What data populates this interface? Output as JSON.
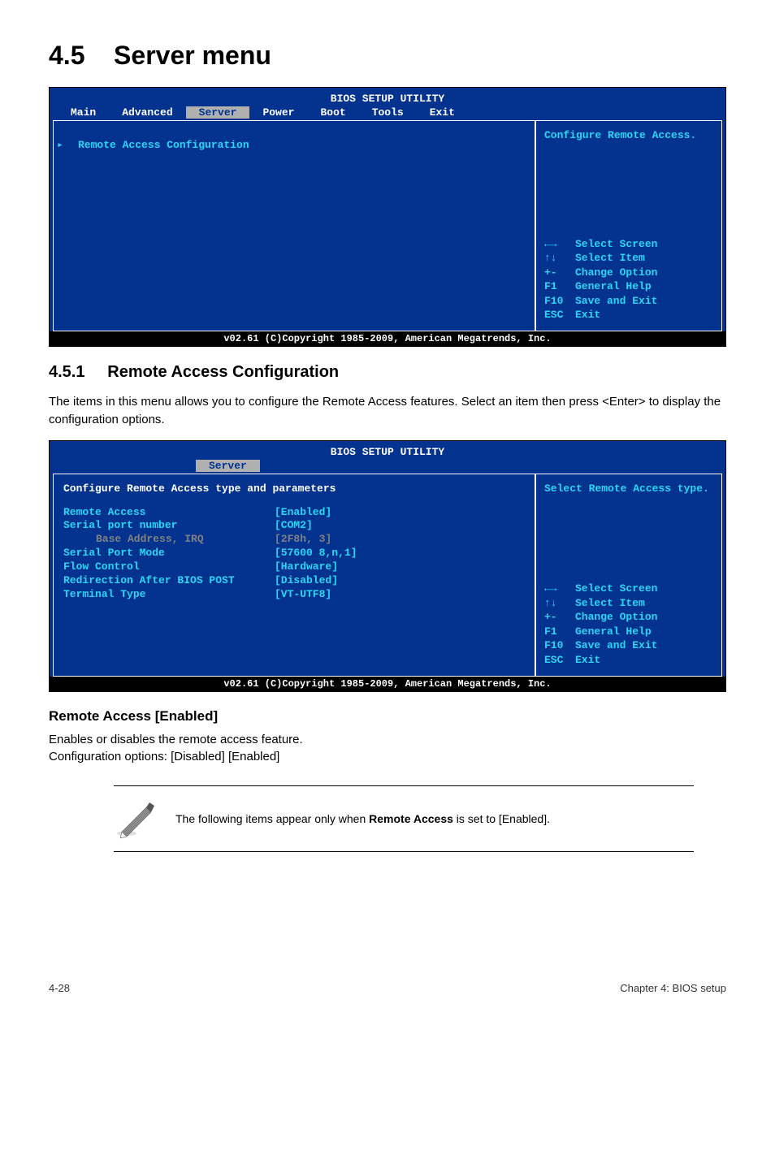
{
  "section_number": "4.5",
  "section_title": "Server menu",
  "bios1": {
    "title": "BIOS SETUP UTILITY",
    "tabs": [
      "Main",
      "Advanced",
      "Server",
      "Power",
      "Boot",
      "Tools",
      "Exit"
    ],
    "selected_tab": "Server",
    "left_item": "Remote Access Configuration",
    "right_top": "Configure Remote Access.",
    "help": [
      {
        "k": "←→",
        "t": "Select Screen"
      },
      {
        "k": "↑↓",
        "t": "Select Item"
      },
      {
        "k": "+-",
        "t": "Change Option"
      },
      {
        "k": "F1",
        "t": "General Help"
      },
      {
        "k": "F10",
        "t": "Save and Exit"
      },
      {
        "k": "ESC",
        "t": "Exit"
      }
    ],
    "footer": "v02.61 (C)Copyright 1985-2009, American Megatrends, Inc."
  },
  "sub_number": "4.5.1",
  "sub_title": "Remote Access Configuration",
  "sub_desc": "The items in this menu allows you to configure the Remote Access features. Select an item then press <Enter> to display the configuration options.",
  "bios2": {
    "title": "BIOS SETUP UTILITY",
    "tab": "Server",
    "heading": "Configure Remote Access type and parameters",
    "rows": [
      {
        "label": "Remote Access",
        "value": "[Enabled]",
        "labelClass": "cyan",
        "valClass": "cyan"
      },
      {
        "label": "",
        "value": "",
        "labelClass": "",
        "valClass": ""
      },
      {
        "label": "Serial port number",
        "value": "[COM2]",
        "labelClass": "cyan",
        "valClass": "cyan"
      },
      {
        "label": "Base Address, IRQ",
        "value": "[2F8h, 3]",
        "labelClass": "gray indent",
        "valClass": "gray"
      },
      {
        "label": "Serial Port Mode",
        "value": "[57600 8,n,1]",
        "labelClass": "cyan",
        "valClass": "cyan"
      },
      {
        "label": "Flow Control",
        "value": "[Hardware]",
        "labelClass": "cyan",
        "valClass": "cyan"
      },
      {
        "label": "Redirection After BIOS POST",
        "value": "[Disabled]",
        "labelClass": "cyan",
        "valClass": "cyan"
      },
      {
        "label": "Terminal Type",
        "value": "[VT-UTF8]",
        "labelClass": "cyan",
        "valClass": "cyan"
      }
    ],
    "right_top": "Select Remote Access type.",
    "help": [
      {
        "k": "←→",
        "t": "Select Screen"
      },
      {
        "k": "↑↓",
        "t": "Select Item"
      },
      {
        "k": "+-",
        "t": "Change Option"
      },
      {
        "k": "F1",
        "t": "General Help"
      },
      {
        "k": "F10",
        "t": "Save and Exit"
      },
      {
        "k": "ESC",
        "t": "Exit"
      }
    ],
    "footer": "v02.61 (C)Copyright 1985-2009, American Megatrends, Inc."
  },
  "option_heading": "Remote Access [Enabled]",
  "option_line1": "Enables or disables the remote access feature.",
  "option_line2": "Configuration options: [Disabled] [Enabled]",
  "note_prefix": "The following items appear only when ",
  "note_bold": "Remote Access",
  "note_suffix": " is set to [Enabled].",
  "page_left": "4-28",
  "page_right": "Chapter 4: BIOS setup"
}
